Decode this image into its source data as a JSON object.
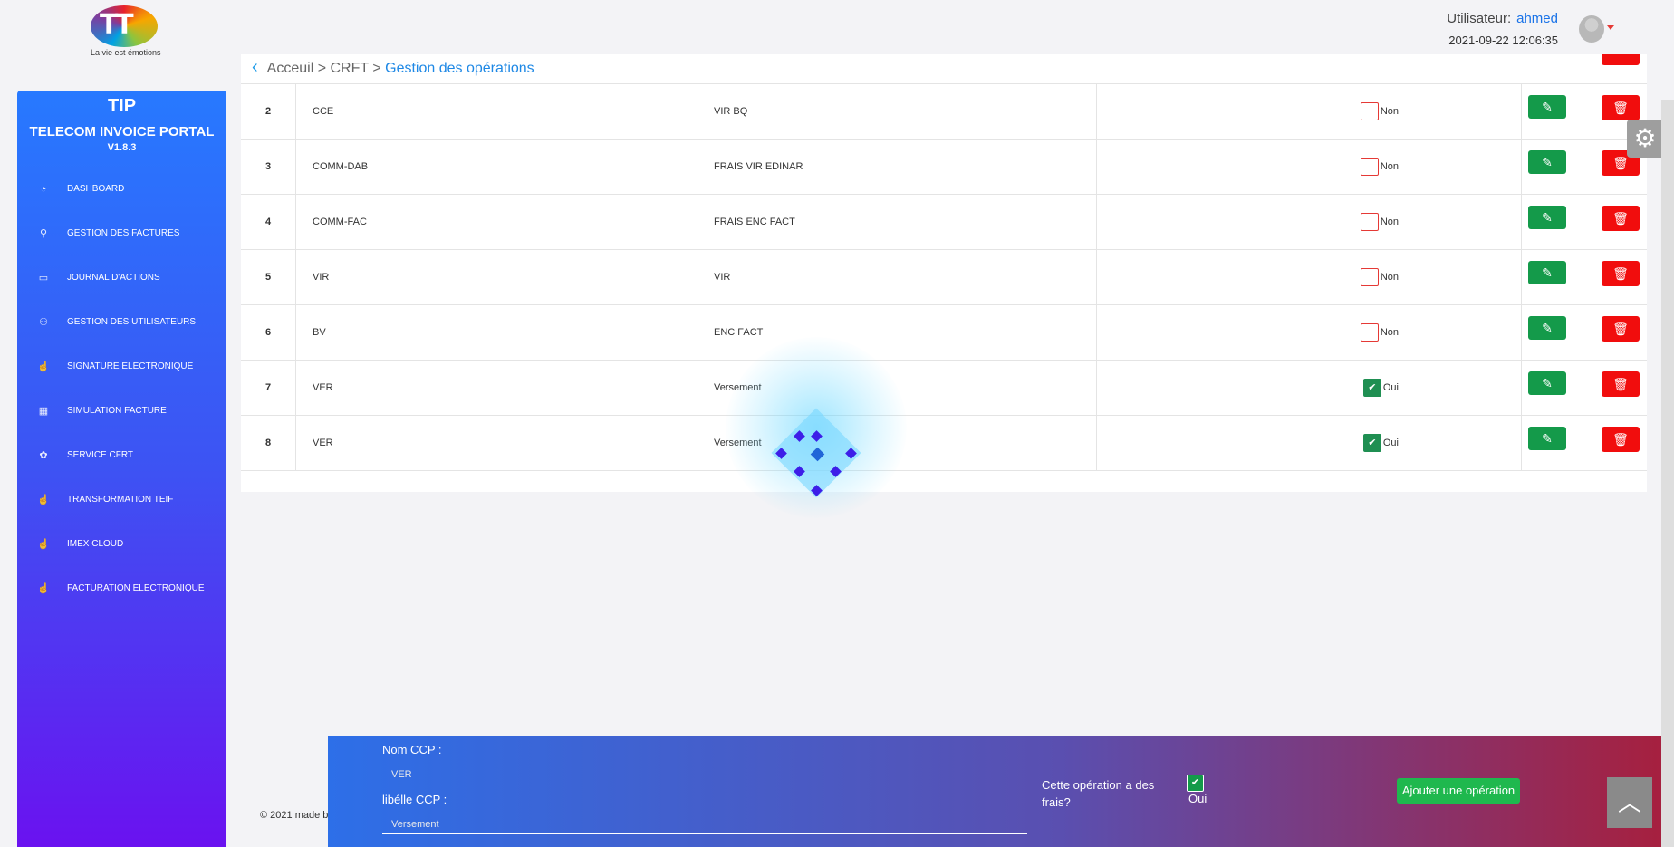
{
  "header": {
    "logo_text": "TT",
    "logo_tagline": "La vie est émotions",
    "user_label": "Utilisateur:",
    "user_name": "ahmed",
    "datetime": "2021-09-22 12:06:35"
  },
  "sidebar": {
    "title": "TIP",
    "subtitle": "TELECOM INVOICE PORTAL",
    "version": "V1.8.3",
    "items": [
      {
        "label": "DASHBOARD",
        "icon": "dashboard-icon"
      },
      {
        "label": "GESTION DES FACTURES",
        "icon": "search-icon"
      },
      {
        "label": "JOURNAL D'ACTIONS",
        "icon": "calendar-icon"
      },
      {
        "label": "GESTION DES UTILISATEURS",
        "icon": "users-icon"
      },
      {
        "label": "SIGNATURE ELECTRONIQUE",
        "icon": "hand-icon"
      },
      {
        "label": "SIMULATION FACTURE",
        "icon": "building-icon"
      },
      {
        "label": "SERVICE CFRT",
        "icon": "puzzle-icon"
      },
      {
        "label": "TRANSFORMATION TEIF",
        "icon": "hand-icon"
      },
      {
        "label": "IMEX CLOUD",
        "icon": "hand-icon"
      },
      {
        "label": "FACTURATION ELECTRONIQUE",
        "icon": "hand-icon"
      }
    ]
  },
  "breadcrumb": {
    "home": "Acceuil",
    "sep1": ">",
    "section": "CRFT",
    "sep2": ">",
    "current": "Gestion des opérations"
  },
  "table": {
    "rows": [
      {
        "num": "2",
        "code": "CCE",
        "libelle": "VIR BQ",
        "frais": "Non",
        "checked": false
      },
      {
        "num": "3",
        "code": "COMM-DAB",
        "libelle": "FRAIS VIR EDINAR",
        "frais": "Non",
        "checked": false
      },
      {
        "num": "4",
        "code": "COMM-FAC",
        "libelle": "FRAIS ENC FACT",
        "frais": "Non",
        "checked": false
      },
      {
        "num": "5",
        "code": "VIR",
        "libelle": "VIR",
        "frais": "Non",
        "checked": false
      },
      {
        "num": "6",
        "code": "BV",
        "libelle": "ENC FACT",
        "frais": "Non",
        "checked": false
      },
      {
        "num": "7",
        "code": "VER",
        "libelle": "Versement",
        "frais": "Oui",
        "checked": true
      },
      {
        "num": "8",
        "code": "VER",
        "libelle": "Versement",
        "frais": "Oui",
        "checked": true
      }
    ]
  },
  "footer": {
    "copyright": "© 2021 made b"
  },
  "form": {
    "nom_label": "Nom CCP :",
    "nom_value": "VER",
    "libelle_label": "libélle CCP :",
    "libelle_value": "Versement",
    "frais_question": "Cette opération a des frais?",
    "frais_answer": "Oui",
    "submit_label": "Ajouter une opération"
  },
  "colors": {
    "edit_button": "#149a4a",
    "delete_button": "#f10d0d",
    "link_blue": "#1e88e5",
    "sidebar_top": "#2779ff",
    "sidebar_bottom": "#6a12f0"
  }
}
